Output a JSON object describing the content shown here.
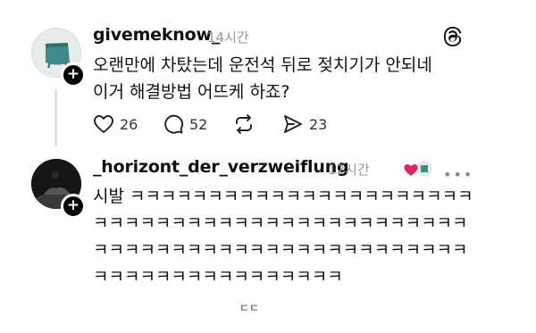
{
  "posts": [
    {
      "username": "givemeknow_",
      "time": "14시간",
      "lines": "오랜만에 차탔는데 운전석 뒤로 젖치기가 안되네\n이거 해결방법 어뜨케 하죠?",
      "actions": {
        "likes": "26",
        "comments": "52",
        "shares": "23"
      }
    },
    {
      "username": "_horizont_der_verzweiflung",
      "time": "12시간",
      "lines": "시발 ㅋㅋㅋㅋㅋㅋㅋㅋㅋㅋㅋㅋㅋㅋㅋㅋㅋㅋㅋㅋㅋㅋ\nㅋㅋㅋㅋㅋㅋㅋㅋㅋㅋㅋㅋㅋㅋㅋㅋㅋㅋㅋㅋㅋㅋㅋㅋ\nㅋㅋㅋㅋㅋㅋㅋㅋㅋㅋㅋㅋㅋㅋㅋㅋㅋㅋㅋㅋㅋㅋㅋㅋ\nㅋㅋㅋㅋㅋㅋㅋㅋㅋㅋㅋㅋㅋㅋㅋㅋ"
    }
  ],
  "footer": "ㄷㄷ",
  "icons": {
    "logo": "threads-logo-icon",
    "like": "heart-icon",
    "comment": "comment-bubble-icon",
    "repost": "repost-icon",
    "share": "send-icon",
    "more": "more-options-icon"
  },
  "colors": {
    "text": "#101010",
    "muted": "#9a9a9a",
    "heart": "#e0245e"
  }
}
